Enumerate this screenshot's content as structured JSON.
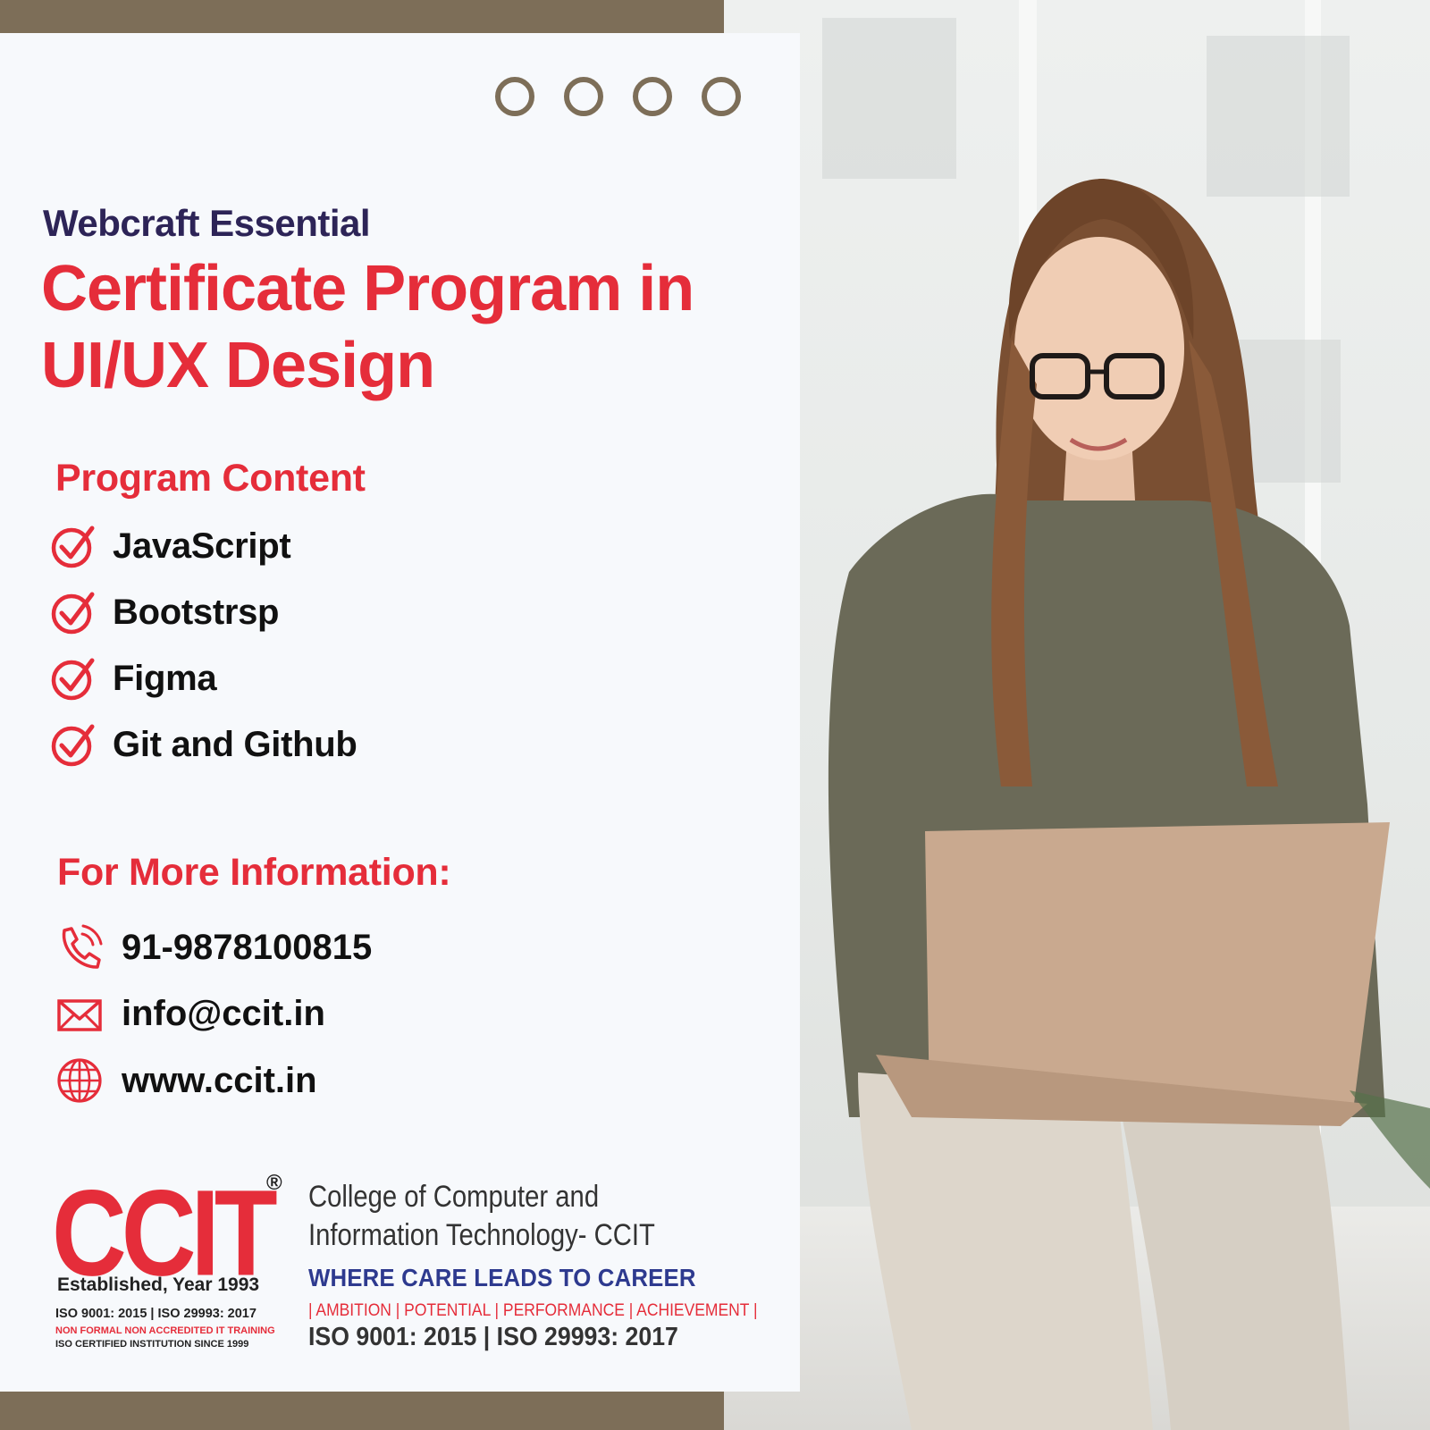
{
  "heading": {
    "subtitle": "Webcraft Essential",
    "title_line1": "Certificate Program in",
    "title_line2": "UI/UX Design"
  },
  "program": {
    "heading": "Program Content",
    "items": [
      {
        "label": "JavaScript",
        "icon": "check-circle-icon"
      },
      {
        "label": "Bootstrsp",
        "icon": "check-circle-icon"
      },
      {
        "label": "Figma",
        "icon": "check-circle-icon"
      },
      {
        "label": "Git and Github",
        "icon": "check-circle-icon"
      }
    ]
  },
  "contact": {
    "heading": "For More Information:",
    "phone": "91-9878100815",
    "email": "info@ccit.in",
    "website": "www.ccit.in"
  },
  "logo": {
    "name": "CCIT",
    "registered": "®",
    "established": "Established, Year 1993",
    "iso": "ISO 9001: 2015 | ISO 29993: 2017",
    "non_formal": "NON FORMAL NON ACCREDITED IT TRAINING",
    "since": "ISO CERTIFIED INSTITUTION SINCE 1999"
  },
  "college": {
    "name_line1": "College of Computer and",
    "name_line2": "Information Technology- CCIT",
    "tagline": "WHERE CARE LEADS TO CAREER",
    "values": "| AMBITION | POTENTIAL |  PERFORMANCE  |  ACHIEVEMENT |",
    "iso": "ISO 9001: 2015 | ISO 29993: 2017"
  },
  "colors": {
    "brand_red": "#e52d3a",
    "brand_navy": "#2d2457",
    "accent_brown": "#7d6e58",
    "tagline_blue": "#2e3a8f"
  }
}
